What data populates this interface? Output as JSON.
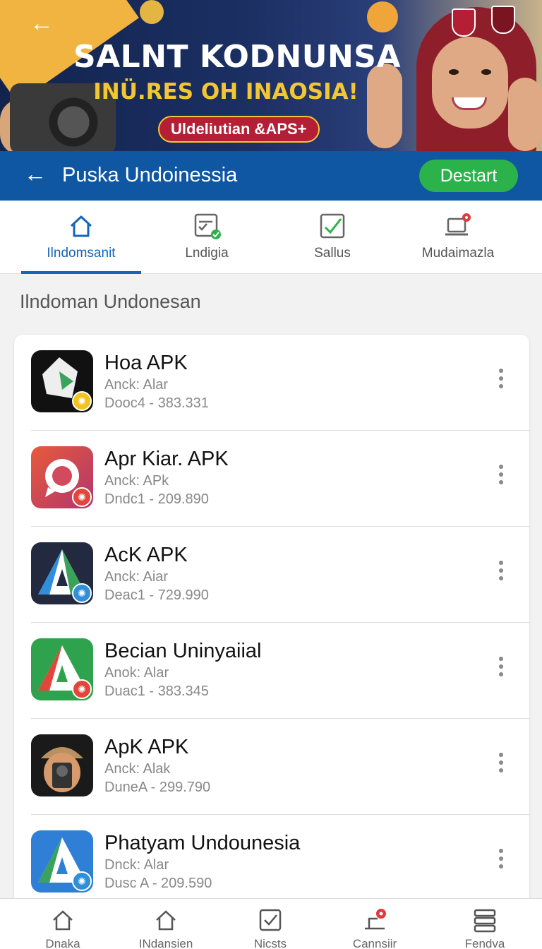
{
  "banner": {
    "title": "SALNT KODNUNSA",
    "subtitle": "INÜ.RES OH INAOSIA!",
    "pill": "Uldeliutian &APS+"
  },
  "header": {
    "title": "Puska Undoinessia",
    "action_label": "Destart"
  },
  "tabs": [
    {
      "label": "Ilndomsanit",
      "icon": "home-icon",
      "active": true
    },
    {
      "label": "Lndigia",
      "icon": "checklist-icon",
      "active": false
    },
    {
      "label": "Sallus",
      "icon": "edit-check-icon",
      "active": false
    },
    {
      "label": "Mudaimazla",
      "icon": "laptop-pin-icon",
      "active": false
    }
  ],
  "section_title": "Ilndoman Undonesan",
  "apps": [
    {
      "name": "Hoa APK",
      "sub": "Anck: Alar",
      "meta": "Dooc4 - 383.331",
      "icon": "diamond-app-icon"
    },
    {
      "name": "Apr Kiar. APK",
      "sub": "Anck: APk",
      "meta": "Dndc1 - 209.890",
      "icon": "chat-bubble-app-icon"
    },
    {
      "name": "AcK APK",
      "sub": "Anck: Aiar",
      "meta": "Deac1 - 729.990",
      "icon": "triangle-app-icon"
    },
    {
      "name": "Becian Uninyaiial",
      "sub": "Anok: Alar",
      "meta": "Duac1 - 383.345",
      "icon": "green-triangle-app-icon"
    },
    {
      "name": "ApK APK",
      "sub": "Anck: Alak",
      "meta": "DuneA - 299.790",
      "icon": "photographer-app-icon"
    },
    {
      "name": "Phatyam Undounesia",
      "sub": "Dnck: Alar",
      "meta": "Dusc A - 209.590",
      "icon": "blue-triangle-app-icon"
    }
  ],
  "bottom_nav": [
    {
      "label": "Dnaka",
      "icon": "home-icon"
    },
    {
      "label": "INdansien",
      "icon": "home-outline-icon"
    },
    {
      "label": "Nicsts",
      "icon": "checkbox-icon"
    },
    {
      "label": "Cannsiir",
      "icon": "map-pin-icon"
    },
    {
      "label": "Fendva",
      "icon": "stack-icon"
    }
  ],
  "colors": {
    "primary": "#0f57a3",
    "accent": "#1565b8",
    "start_button": "#2cb24a",
    "banner_bg": "#12244e"
  }
}
